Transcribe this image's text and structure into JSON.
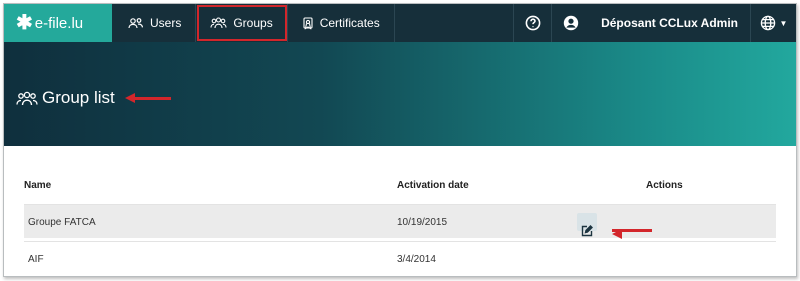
{
  "brand": {
    "name": "e-file.lu",
    "mark": "✱"
  },
  "nav": {
    "users": "Users",
    "groups": "Groups",
    "certificates": "Certificates",
    "user_name": "Déposant CCLux Admin",
    "help_icon": "question-circle-icon",
    "user_icon": "user-circle-icon",
    "lang_icon": "globe-icon"
  },
  "page": {
    "title": "Group list"
  },
  "table": {
    "headers": {
      "name": "Name",
      "activation_date": "Activation date",
      "actions": "Actions"
    },
    "rows": [
      {
        "name": "Groupe FATCA",
        "activation_date": "10/19/2015",
        "has_edit": true
      },
      {
        "name": "AIF",
        "activation_date": "3/4/2014",
        "has_edit": false
      }
    ]
  },
  "colors": {
    "brand": "#24a99b",
    "navbar": "#162f3a",
    "highlight": "#d3262b"
  }
}
